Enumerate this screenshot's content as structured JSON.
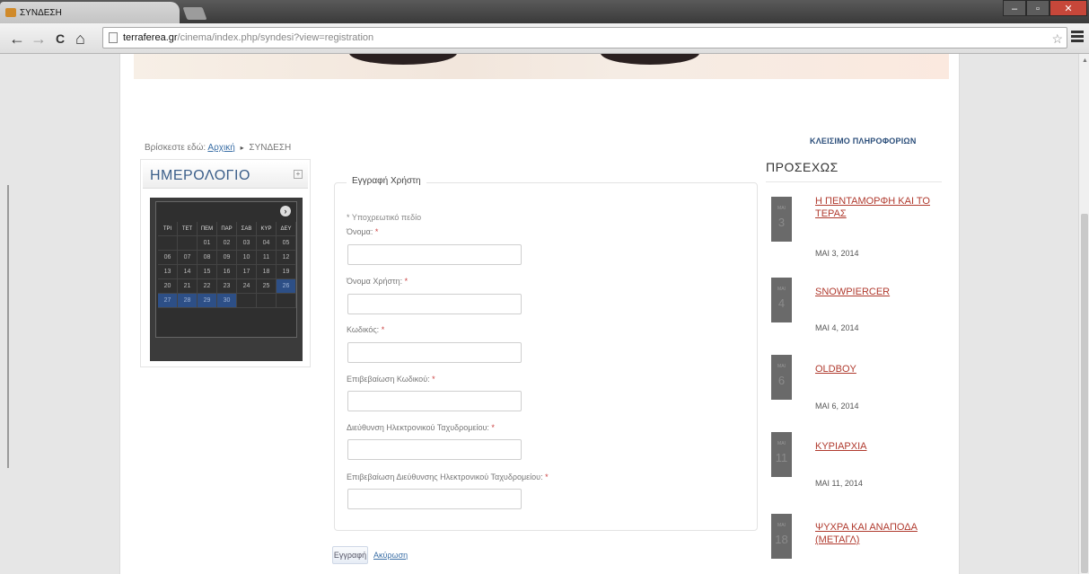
{
  "browser": {
    "tab_title": "ΣΥΝΔΕΣΗ",
    "url_domain": "terraferea.gr",
    "url_path": "/cinema/index.php/syndesi?view=registration",
    "back_glyph": "←",
    "forward_glyph": "→",
    "reload_glyph": "C",
    "home_glyph": "⌂",
    "star_glyph": "☆",
    "window_controls": [
      "–",
      "▫",
      "✕"
    ]
  },
  "breadcrumb": {
    "prefix": "Βρίσκεστε εδώ:",
    "home_link": "Αρχική",
    "separator": "▸",
    "current": "ΣΥΝΔΕΣΗ"
  },
  "header_link": "ΚΛΕΙΣΙΜΟ ΠΛΗΡΟΦΟΡΙΩΝ",
  "calendar": {
    "title": "ΗΜΕΡΟΛΟΓΙΟ",
    "toggle": "+",
    "next_glyph": "›",
    "day_headers": [
      "ΤΡΙ",
      "ΤΕΤ",
      "ΠΕΜ",
      "ΠΑΡ",
      "ΣΑΒ",
      "ΚΥΡ",
      "ΔΕΥ"
    ],
    "weeks": [
      [
        "",
        "",
        "01",
        "02",
        "03",
        "04",
        "05"
      ],
      [
        "06",
        "07",
        "08",
        "09",
        "10",
        "11",
        "12"
      ],
      [
        "13",
        "14",
        "15",
        "16",
        "17",
        "18",
        "19"
      ],
      [
        "20",
        "21",
        "22",
        "23",
        "24",
        "25",
        "26"
      ],
      [
        "27",
        "28",
        "29",
        "30",
        "",
        "",
        ""
      ]
    ]
  },
  "form": {
    "legend": "Εγγραφή Χρήστη",
    "required_note": "* Υποχρεωτικό πεδίο",
    "required_mark": "*",
    "fields": [
      {
        "label": "Όνομα:",
        "value": ""
      },
      {
        "label": "Όνομα Χρήστη:",
        "value": ""
      },
      {
        "label": "Κωδικός:",
        "value": ""
      },
      {
        "label": "Επιβεβαίωση Κωδικού:",
        "value": ""
      },
      {
        "label": "Διεύθυνση Ηλεκτρονικού Ταχυδρομείου:",
        "value": ""
      },
      {
        "label": "Επιβεβαίωση Διεύθυνσης Ηλεκτρονικού Ταχυδρομείου:",
        "value": ""
      }
    ],
    "register_button": "Εγγραφή",
    "cancel_link": "Ακύρωση"
  },
  "sidebar": {
    "heading": "ΠΡΟΣΕΧΩΣ",
    "events": [
      {
        "title": "Η ΠΕΝΤΑΜΟΡΦΗ ΚΑΙ ΤΟ ΤΕΡΑΣ",
        "date": "ΜΑΙ 3, 2014",
        "month": "ΜΑΙ",
        "day": "3"
      },
      {
        "title": "SNOWPIERCER",
        "date": "ΜΑΙ 4, 2014",
        "month": "ΜΑΙ",
        "day": "4"
      },
      {
        "title": "OLDBOY",
        "date": "ΜΑΙ 6, 2014",
        "month": "ΜΑΙ",
        "day": "6"
      },
      {
        "title": "ΚΥΡΙΑΡΧΙΑ",
        "date": "ΜΑΙ 11, 2014",
        "month": "ΜΑΙ",
        "day": "11"
      },
      {
        "title": "ΨΥΧΡΑ ΚΑΙ ΑΝΑΠΟΔΑ (ΜΕΤΑΓΛ)",
        "date": "",
        "month": "ΜΑΙ",
        "day": "18"
      }
    ]
  }
}
